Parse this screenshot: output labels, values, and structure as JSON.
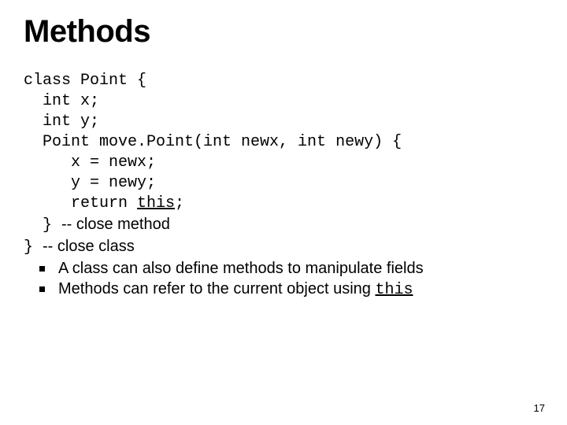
{
  "title": "Methods",
  "code": {
    "l1": "class Point {",
    "l2": "  int x;",
    "l3": "  int y;",
    "l4": "  Point move.Point(int newx, int newy) {",
    "l5": "     x = newx;",
    "l6": "     y = newy;",
    "l7a": "     return ",
    "this1": "this",
    "l7b": ";",
    "l8a": "  } ",
    "l8b": "-- close method",
    "l9a": "} ",
    "l9b": "-- close class"
  },
  "bullets": {
    "b1": "A class can also define methods to manipulate fields",
    "b2a": "Methods can refer to the current object using ",
    "b2b": "this"
  },
  "page": "17"
}
